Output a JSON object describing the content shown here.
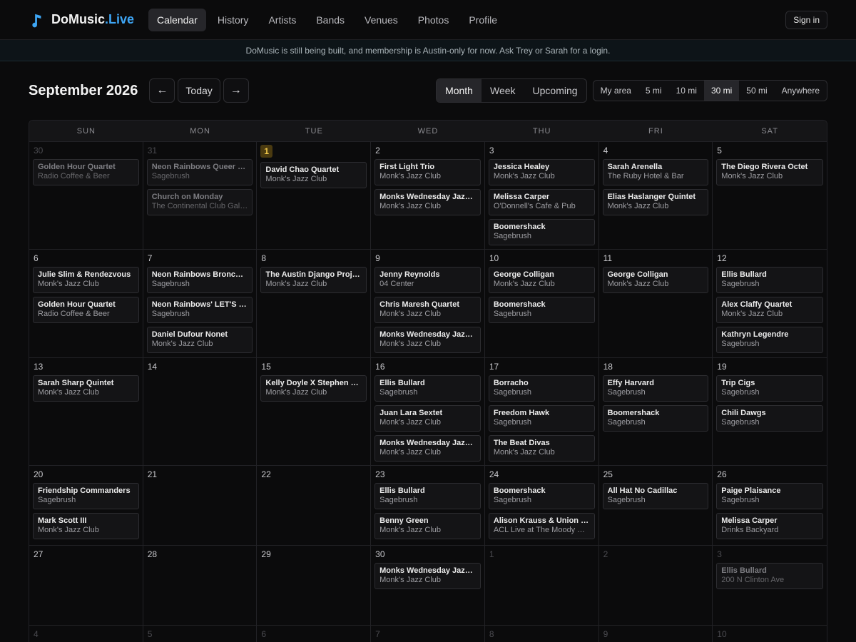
{
  "brand": {
    "name": "DoMusic",
    "accent": ".Live",
    "icon": "music-note-icon",
    "accent_color": "#3ea6f5"
  },
  "nav": [
    {
      "label": "Calendar",
      "active": true
    },
    {
      "label": "History"
    },
    {
      "label": "Artists"
    },
    {
      "label": "Bands"
    },
    {
      "label": "Venues"
    },
    {
      "label": "Photos"
    },
    {
      "label": "Profile"
    }
  ],
  "signin_label": "Sign in",
  "notice": "DoMusic is still being built, and membership is Austin-only for now. Ask Trey or Sarah for a login.",
  "toolbar": {
    "month_title": "September 2026",
    "prev_label": "←",
    "today_label": "Today",
    "next_label": "→",
    "views": [
      {
        "label": "Month",
        "active": true
      },
      {
        "label": "Week"
      },
      {
        "label": "Upcoming"
      }
    ],
    "distances": [
      {
        "label": "My area"
      },
      {
        "label": "5 mi"
      },
      {
        "label": "10 mi"
      },
      {
        "label": "30 mi",
        "active": true
      },
      {
        "label": "50 mi"
      },
      {
        "label": "Anywhere"
      }
    ]
  },
  "weekdays": [
    "SUN",
    "MON",
    "TUE",
    "WED",
    "THU",
    "FRI",
    "SAT"
  ],
  "weeks": [
    [
      {
        "num": "30",
        "muted": true,
        "events": [
          {
            "title": "Golden Hour Quartet",
            "venue": "Radio Coffee & Beer"
          }
        ]
      },
      {
        "num": "31",
        "muted": true,
        "events": [
          {
            "title": "Neon Rainbows Queer Country",
            "venue": "Sagebrush"
          },
          {
            "title": "Church on Monday",
            "venue": "The Continental Club Gallery"
          }
        ]
      },
      {
        "num": "1",
        "today": true,
        "events": [
          {
            "title": "David Chao Quartet",
            "venue": "Monk's Jazz Club"
          }
        ]
      },
      {
        "num": "2",
        "events": [
          {
            "title": "First Light Trio",
            "venue": "Monk's Jazz Club"
          },
          {
            "title": "Monks Wednesday Jazz Jam",
            "venue": "Monk's Jazz Club"
          }
        ]
      },
      {
        "num": "3",
        "events": [
          {
            "title": "Jessica Healey",
            "venue": "Monk's Jazz Club"
          },
          {
            "title": "Melissa Carper",
            "venue": "O'Donnell's Cafe & Pub"
          },
          {
            "title": "Boomershack",
            "venue": "Sagebrush"
          }
        ]
      },
      {
        "num": "4",
        "events": [
          {
            "title": "Sarah Arenella",
            "venue": "The Ruby Hotel & Bar"
          },
          {
            "title": "Elias Haslanger Quintet",
            "venue": "Monk's Jazz Club"
          }
        ]
      },
      {
        "num": "5",
        "events": [
          {
            "title": "The Diego Rivera Octet",
            "venue": "Monk's Jazz Club"
          }
        ]
      }
    ],
    [
      {
        "num": "6",
        "events": [
          {
            "title": "Julie Slim & Rendezvous",
            "venue": "Monk's Jazz Club"
          },
          {
            "title": "Golden Hour Quartet",
            "venue": "Radio Coffee & Beer"
          }
        ]
      },
      {
        "num": "7",
        "events": [
          {
            "title": "Neon Rainbows Broncos Night",
            "venue": "Sagebrush"
          },
          {
            "title": "Neon Rainbows' LET'S DANCE",
            "venue": "Sagebrush"
          },
          {
            "title": "Daniel Dufour Nonet",
            "venue": "Monk's Jazz Club"
          }
        ]
      },
      {
        "num": "8",
        "events": [
          {
            "title": "The Austin Django Project",
            "venue": "Monk's Jazz Club"
          }
        ]
      },
      {
        "num": "9",
        "events": [
          {
            "title": "Jenny Reynolds",
            "venue": "04 Center"
          },
          {
            "title": "Chris Maresh Quartet",
            "venue": "Monk's Jazz Club"
          },
          {
            "title": "Monks Wednesday Jazz Jam",
            "venue": "Monk's Jazz Club"
          }
        ]
      },
      {
        "num": "10",
        "events": [
          {
            "title": "George Colligan",
            "venue": "Monk's Jazz Club"
          },
          {
            "title": "Boomershack",
            "venue": "Sagebrush"
          }
        ]
      },
      {
        "num": "11",
        "events": [
          {
            "title": "George Colligan",
            "venue": "Monk's Jazz Club"
          }
        ]
      },
      {
        "num": "12",
        "events": [
          {
            "title": "Ellis Bullard",
            "venue": "Sagebrush"
          },
          {
            "title": "Alex Claffy Quartet",
            "venue": "Monk's Jazz Club"
          },
          {
            "title": "Kathryn Legendre",
            "venue": "Sagebrush"
          }
        ]
      }
    ],
    [
      {
        "num": "13",
        "events": [
          {
            "title": "Sarah Sharp Quintet",
            "venue": "Monk's Jazz Club"
          }
        ]
      },
      {
        "num": "14",
        "events": []
      },
      {
        "num": "15",
        "events": [
          {
            "title": "Kelly Doyle X Stephen Barber",
            "venue": "Monk's Jazz Club"
          }
        ]
      },
      {
        "num": "16",
        "events": [
          {
            "title": "Ellis Bullard",
            "venue": "Sagebrush"
          },
          {
            "title": "Juan Lara Sextet",
            "venue": "Monk's Jazz Club"
          },
          {
            "title": "Monks Wednesday Jazz Jam",
            "venue": "Monk's Jazz Club"
          }
        ]
      },
      {
        "num": "17",
        "events": [
          {
            "title": "Borracho",
            "venue": "Sagebrush"
          },
          {
            "title": "Freedom Hawk",
            "venue": "Sagebrush"
          },
          {
            "title": "The Beat Divas",
            "venue": "Monk's Jazz Club"
          }
        ]
      },
      {
        "num": "18",
        "events": [
          {
            "title": "Effy Harvard",
            "venue": "Sagebrush"
          },
          {
            "title": "Boomershack",
            "venue": "Sagebrush"
          }
        ]
      },
      {
        "num": "19",
        "events": [
          {
            "title": "Trip Cigs",
            "venue": "Sagebrush"
          },
          {
            "title": "Chili Dawgs",
            "venue": "Sagebrush"
          }
        ]
      }
    ],
    [
      {
        "num": "20",
        "events": [
          {
            "title": "Friendship Commanders",
            "venue": "Sagebrush"
          },
          {
            "title": "Mark Scott III",
            "venue": "Monk's Jazz Club"
          }
        ]
      },
      {
        "num": "21",
        "events": []
      },
      {
        "num": "22",
        "events": []
      },
      {
        "num": "23",
        "events": [
          {
            "title": "Ellis Bullard",
            "venue": "Sagebrush"
          },
          {
            "title": "Benny Green",
            "venue": "Monk's Jazz Club"
          }
        ]
      },
      {
        "num": "24",
        "events": [
          {
            "title": "Boomershack",
            "venue": "Sagebrush"
          },
          {
            "title": "Alison Krauss & Union Station",
            "venue": "ACL Live at The Moody Theater"
          }
        ]
      },
      {
        "num": "25",
        "events": [
          {
            "title": "All Hat No Cadillac",
            "venue": "Sagebrush"
          }
        ]
      },
      {
        "num": "26",
        "events": [
          {
            "title": "Paige Plaisance",
            "venue": "Sagebrush"
          },
          {
            "title": "Melissa Carper",
            "venue": "Drinks Backyard"
          }
        ]
      }
    ],
    [
      {
        "num": "27",
        "events": []
      },
      {
        "num": "28",
        "events": []
      },
      {
        "num": "29",
        "events": []
      },
      {
        "num": "30",
        "events": [
          {
            "title": "Monks Wednesday Jazz Jam",
            "venue": "Monk's Jazz Club"
          }
        ]
      },
      {
        "num": "1",
        "muted": true,
        "events": []
      },
      {
        "num": "2",
        "muted": true,
        "events": []
      },
      {
        "num": "3",
        "muted": true,
        "events": [
          {
            "title": "Ellis Bullard",
            "venue": "200 N Clinton Ave"
          }
        ]
      }
    ],
    [
      {
        "num": "4",
        "muted": true,
        "events": []
      },
      {
        "num": "5",
        "muted": true,
        "events": []
      },
      {
        "num": "6",
        "muted": true,
        "events": []
      },
      {
        "num": "7",
        "muted": true,
        "events": []
      },
      {
        "num": "8",
        "muted": true,
        "events": []
      },
      {
        "num": "9",
        "muted": true,
        "events": []
      },
      {
        "num": "10",
        "muted": true,
        "events": []
      }
    ]
  ]
}
